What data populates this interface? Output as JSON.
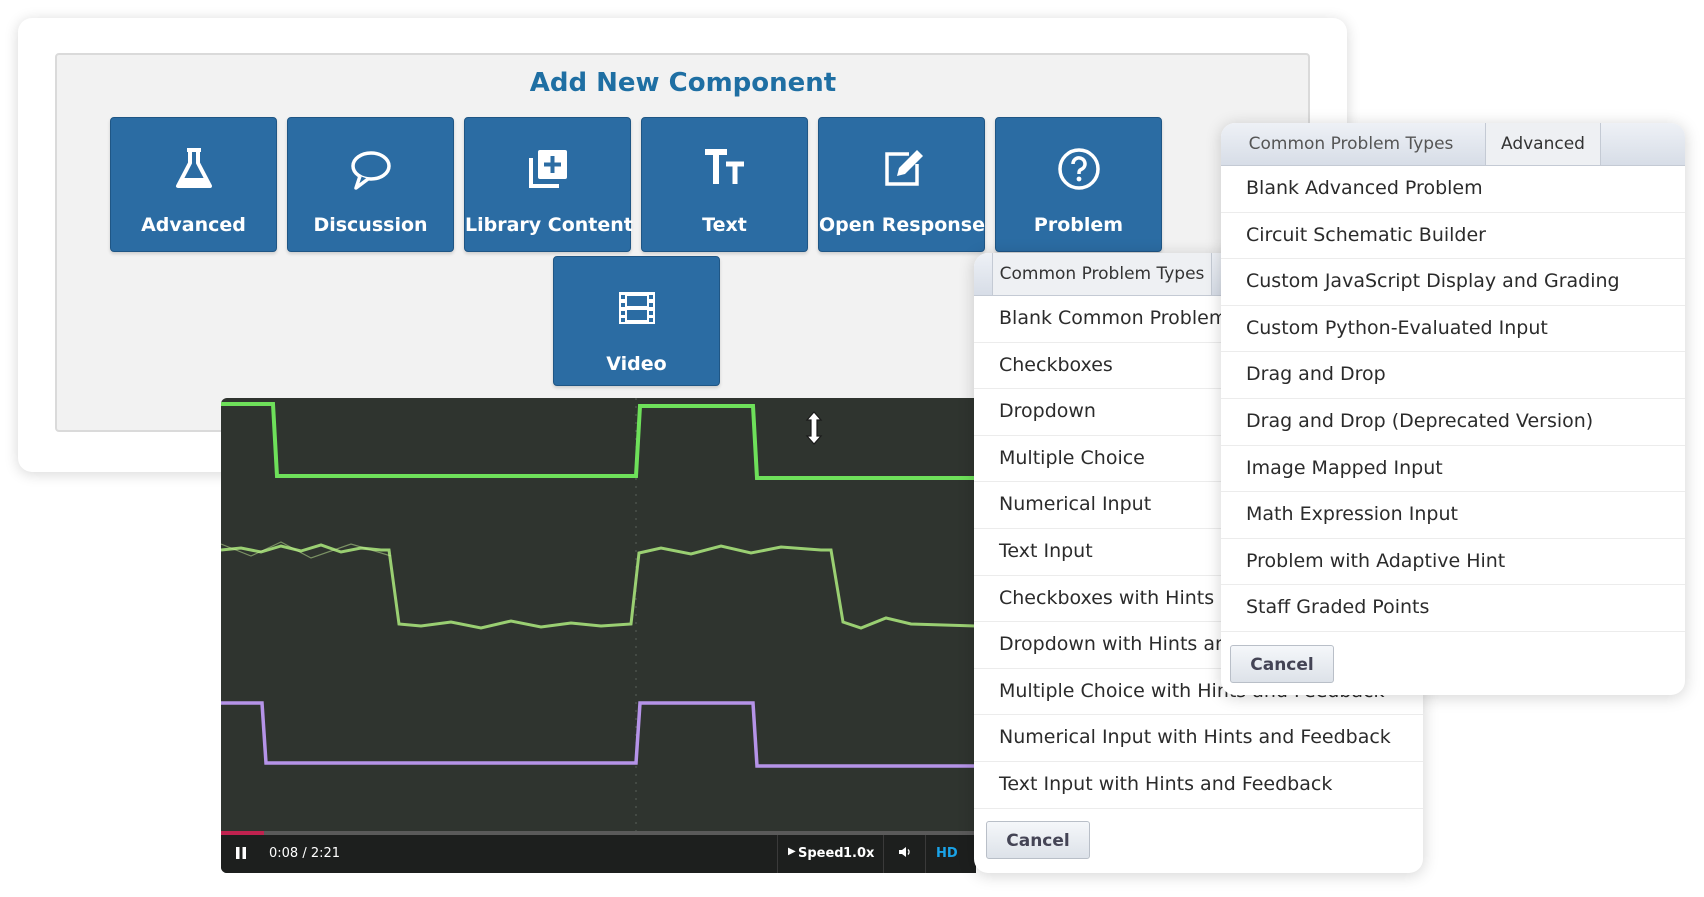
{
  "adder": {
    "title": "Add New Component",
    "buttons": [
      {
        "label": "Advanced",
        "icon": "flask-icon"
      },
      {
        "label": "Discussion",
        "icon": "speech-bubble-icon"
      },
      {
        "label": "Library Content",
        "icon": "library-add-icon"
      },
      {
        "label": "Text",
        "icon": "text-size-icon"
      },
      {
        "label": "Open Response",
        "icon": "edit-icon"
      },
      {
        "label": "Problem",
        "icon": "question-circle-icon"
      },
      {
        "label": "Video",
        "icon": "film-icon"
      }
    ]
  },
  "video": {
    "time": "0:08 / 2:21",
    "progress": 0.057,
    "speed_label": "Speed",
    "speed_value": "1.0x",
    "hd_label": "HD",
    "accent": "#c0224f"
  },
  "common_panel": {
    "tab_label": "Common Problem Types",
    "items": [
      "Blank Common Problem",
      "Checkboxes",
      "Dropdown",
      "Multiple Choice",
      "Numerical Input",
      "Text Input",
      "Checkboxes with Hints and Feedback",
      "Dropdown with Hints and Feedback",
      "Multiple Choice with Hints and Feedback",
      "Numerical Input with Hints and Feedback",
      "Text Input with Hints and Feedback"
    ],
    "cancel_label": "Cancel"
  },
  "advanced_panel": {
    "tabs": [
      "Common Problem Types",
      "Advanced"
    ],
    "items": [
      "Blank Advanced Problem",
      "Circuit Schematic Builder",
      "Custom JavaScript Display and Grading",
      "Custom Python-Evaluated Input",
      "Drag and Drop",
      "Drag and Drop (Deprecated Version)",
      "Image Mapped Input",
      "Math Expression Input",
      "Problem with Adaptive Hint",
      "Staff Graded Points"
    ],
    "cancel_label": "Cancel"
  },
  "colors": {
    "button_blue": "#2b6ca3",
    "title_blue": "#1f6fa3",
    "trace_green": "#7fe36a",
    "trace_purple": "#b593e8"
  }
}
